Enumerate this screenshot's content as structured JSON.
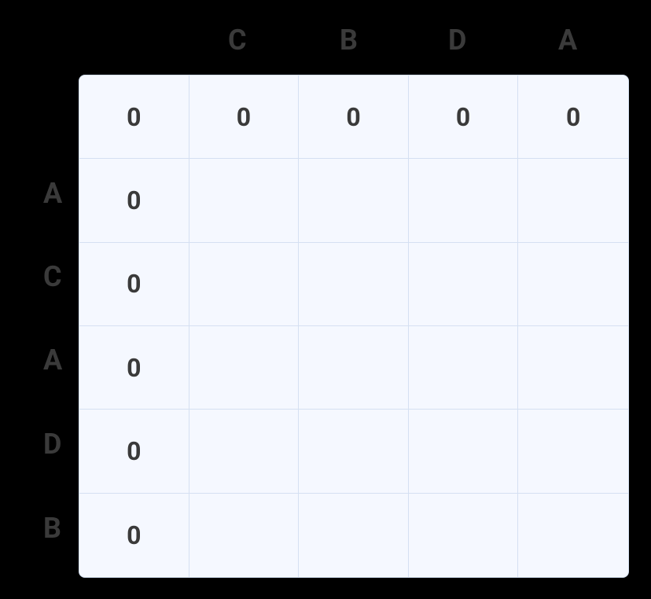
{
  "columns": [
    "C",
    "B",
    "D",
    "A"
  ],
  "rows": [
    "A",
    "C",
    "A",
    "D",
    "B"
  ],
  "grid": [
    [
      "0",
      "0",
      "0",
      "0",
      "0"
    ],
    [
      "0",
      "",
      "",
      "",
      ""
    ],
    [
      "0",
      "",
      "",
      "",
      ""
    ],
    [
      "0",
      "",
      "",
      "",
      ""
    ],
    [
      "0",
      "",
      "",
      "",
      ""
    ],
    [
      "0",
      "",
      "",
      "",
      ""
    ]
  ],
  "layout": {
    "colStartX": 290,
    "colGap": 140,
    "colY": 30,
    "rowStartY": 225,
    "rowGap": 106,
    "rowX": 55
  }
}
